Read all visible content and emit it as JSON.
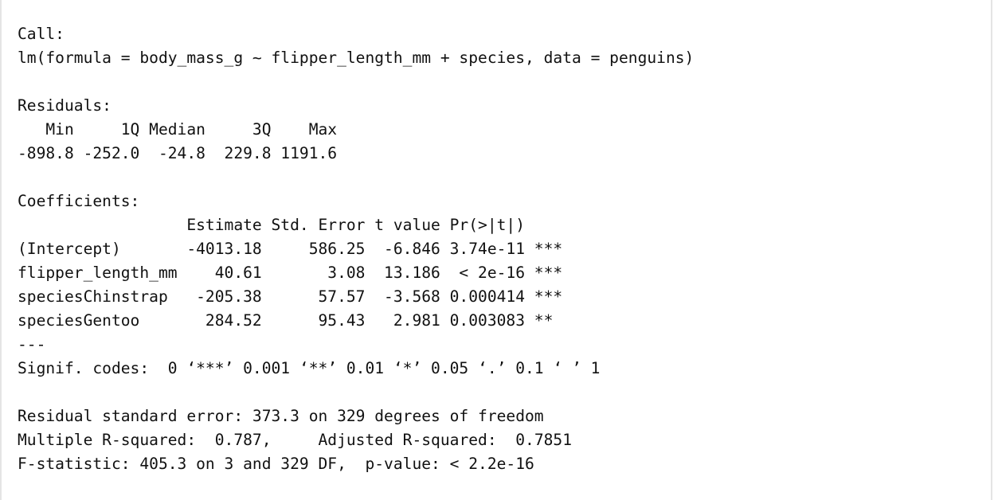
{
  "console": {
    "lines": [
      "Call:",
      "lm(formula = body_mass_g ~ flipper_length_mm + species, data = penguins)",
      "",
      "Residuals:",
      "   Min     1Q Median     3Q    Max ",
      "-898.8 -252.0  -24.8  229.8 1191.6 ",
      "",
      "Coefficients:",
      "                  Estimate Std. Error t value Pr(>|t|)    ",
      "(Intercept)       -4013.18     586.25  -6.846 3.74e-11 ***",
      "flipper_length_mm    40.61       3.08  13.186  < 2e-16 ***",
      "speciesChinstrap   -205.38      57.57  -3.568 0.000414 ***",
      "speciesGentoo       284.52      95.43   2.981 0.003083 ** ",
      "---",
      "Signif. codes:  0 ‘***’ 0.001 ‘**’ 0.01 ‘*’ 0.05 ‘.’ 0.1 ‘ ’ 1",
      "",
      "Residual standard error: 373.3 on 329 degrees of freedom",
      "Multiple R-squared:  0.787,\tAdjusted R-squared:  0.7851 ",
      "F-statistic: 405.3 on 3 and 329 DF,  p-value: < 2.2e-16"
    ]
  }
}
